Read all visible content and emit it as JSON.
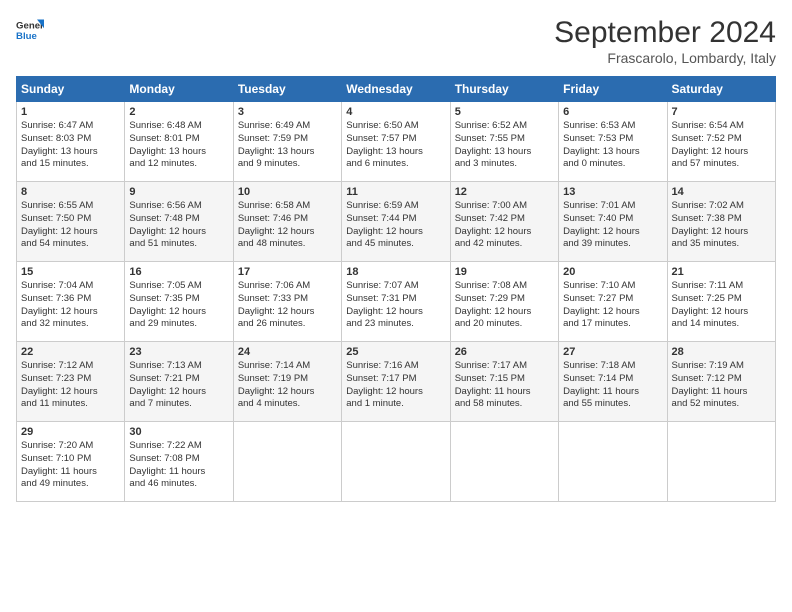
{
  "logo": {
    "line1": "General",
    "line2": "Blue"
  },
  "title": "September 2024",
  "location": "Frascarolo, Lombardy, Italy",
  "headers": [
    "Sunday",
    "Monday",
    "Tuesday",
    "Wednesday",
    "Thursday",
    "Friday",
    "Saturday"
  ],
  "weeks": [
    [
      {
        "day": "1",
        "lines": [
          "Sunrise: 6:47 AM",
          "Sunset: 8:03 PM",
          "Daylight: 13 hours",
          "and 15 minutes."
        ]
      },
      {
        "day": "2",
        "lines": [
          "Sunrise: 6:48 AM",
          "Sunset: 8:01 PM",
          "Daylight: 13 hours",
          "and 12 minutes."
        ]
      },
      {
        "day": "3",
        "lines": [
          "Sunrise: 6:49 AM",
          "Sunset: 7:59 PM",
          "Daylight: 13 hours",
          "and 9 minutes."
        ]
      },
      {
        "day": "4",
        "lines": [
          "Sunrise: 6:50 AM",
          "Sunset: 7:57 PM",
          "Daylight: 13 hours",
          "and 6 minutes."
        ]
      },
      {
        "day": "5",
        "lines": [
          "Sunrise: 6:52 AM",
          "Sunset: 7:55 PM",
          "Daylight: 13 hours",
          "and 3 minutes."
        ]
      },
      {
        "day": "6",
        "lines": [
          "Sunrise: 6:53 AM",
          "Sunset: 7:53 PM",
          "Daylight: 13 hours",
          "and 0 minutes."
        ]
      },
      {
        "day": "7",
        "lines": [
          "Sunrise: 6:54 AM",
          "Sunset: 7:52 PM",
          "Daylight: 12 hours",
          "and 57 minutes."
        ]
      }
    ],
    [
      {
        "day": "8",
        "lines": [
          "Sunrise: 6:55 AM",
          "Sunset: 7:50 PM",
          "Daylight: 12 hours",
          "and 54 minutes."
        ]
      },
      {
        "day": "9",
        "lines": [
          "Sunrise: 6:56 AM",
          "Sunset: 7:48 PM",
          "Daylight: 12 hours",
          "and 51 minutes."
        ]
      },
      {
        "day": "10",
        "lines": [
          "Sunrise: 6:58 AM",
          "Sunset: 7:46 PM",
          "Daylight: 12 hours",
          "and 48 minutes."
        ]
      },
      {
        "day": "11",
        "lines": [
          "Sunrise: 6:59 AM",
          "Sunset: 7:44 PM",
          "Daylight: 12 hours",
          "and 45 minutes."
        ]
      },
      {
        "day": "12",
        "lines": [
          "Sunrise: 7:00 AM",
          "Sunset: 7:42 PM",
          "Daylight: 12 hours",
          "and 42 minutes."
        ]
      },
      {
        "day": "13",
        "lines": [
          "Sunrise: 7:01 AM",
          "Sunset: 7:40 PM",
          "Daylight: 12 hours",
          "and 39 minutes."
        ]
      },
      {
        "day": "14",
        "lines": [
          "Sunrise: 7:02 AM",
          "Sunset: 7:38 PM",
          "Daylight: 12 hours",
          "and 35 minutes."
        ]
      }
    ],
    [
      {
        "day": "15",
        "lines": [
          "Sunrise: 7:04 AM",
          "Sunset: 7:36 PM",
          "Daylight: 12 hours",
          "and 32 minutes."
        ]
      },
      {
        "day": "16",
        "lines": [
          "Sunrise: 7:05 AM",
          "Sunset: 7:35 PM",
          "Daylight: 12 hours",
          "and 29 minutes."
        ]
      },
      {
        "day": "17",
        "lines": [
          "Sunrise: 7:06 AM",
          "Sunset: 7:33 PM",
          "Daylight: 12 hours",
          "and 26 minutes."
        ]
      },
      {
        "day": "18",
        "lines": [
          "Sunrise: 7:07 AM",
          "Sunset: 7:31 PM",
          "Daylight: 12 hours",
          "and 23 minutes."
        ]
      },
      {
        "day": "19",
        "lines": [
          "Sunrise: 7:08 AM",
          "Sunset: 7:29 PM",
          "Daylight: 12 hours",
          "and 20 minutes."
        ]
      },
      {
        "day": "20",
        "lines": [
          "Sunrise: 7:10 AM",
          "Sunset: 7:27 PM",
          "Daylight: 12 hours",
          "and 17 minutes."
        ]
      },
      {
        "day": "21",
        "lines": [
          "Sunrise: 7:11 AM",
          "Sunset: 7:25 PM",
          "Daylight: 12 hours",
          "and 14 minutes."
        ]
      }
    ],
    [
      {
        "day": "22",
        "lines": [
          "Sunrise: 7:12 AM",
          "Sunset: 7:23 PM",
          "Daylight: 12 hours",
          "and 11 minutes."
        ]
      },
      {
        "day": "23",
        "lines": [
          "Sunrise: 7:13 AM",
          "Sunset: 7:21 PM",
          "Daylight: 12 hours",
          "and 7 minutes."
        ]
      },
      {
        "day": "24",
        "lines": [
          "Sunrise: 7:14 AM",
          "Sunset: 7:19 PM",
          "Daylight: 12 hours",
          "and 4 minutes."
        ]
      },
      {
        "day": "25",
        "lines": [
          "Sunrise: 7:16 AM",
          "Sunset: 7:17 PM",
          "Daylight: 12 hours",
          "and 1 minute."
        ]
      },
      {
        "day": "26",
        "lines": [
          "Sunrise: 7:17 AM",
          "Sunset: 7:15 PM",
          "Daylight: 11 hours",
          "and 58 minutes."
        ]
      },
      {
        "day": "27",
        "lines": [
          "Sunrise: 7:18 AM",
          "Sunset: 7:14 PM",
          "Daylight: 11 hours",
          "and 55 minutes."
        ]
      },
      {
        "day": "28",
        "lines": [
          "Sunrise: 7:19 AM",
          "Sunset: 7:12 PM",
          "Daylight: 11 hours",
          "and 52 minutes."
        ]
      }
    ],
    [
      {
        "day": "29",
        "lines": [
          "Sunrise: 7:20 AM",
          "Sunset: 7:10 PM",
          "Daylight: 11 hours",
          "and 49 minutes."
        ]
      },
      {
        "day": "30",
        "lines": [
          "Sunrise: 7:22 AM",
          "Sunset: 7:08 PM",
          "Daylight: 11 hours",
          "and 46 minutes."
        ]
      },
      null,
      null,
      null,
      null,
      null
    ]
  ]
}
